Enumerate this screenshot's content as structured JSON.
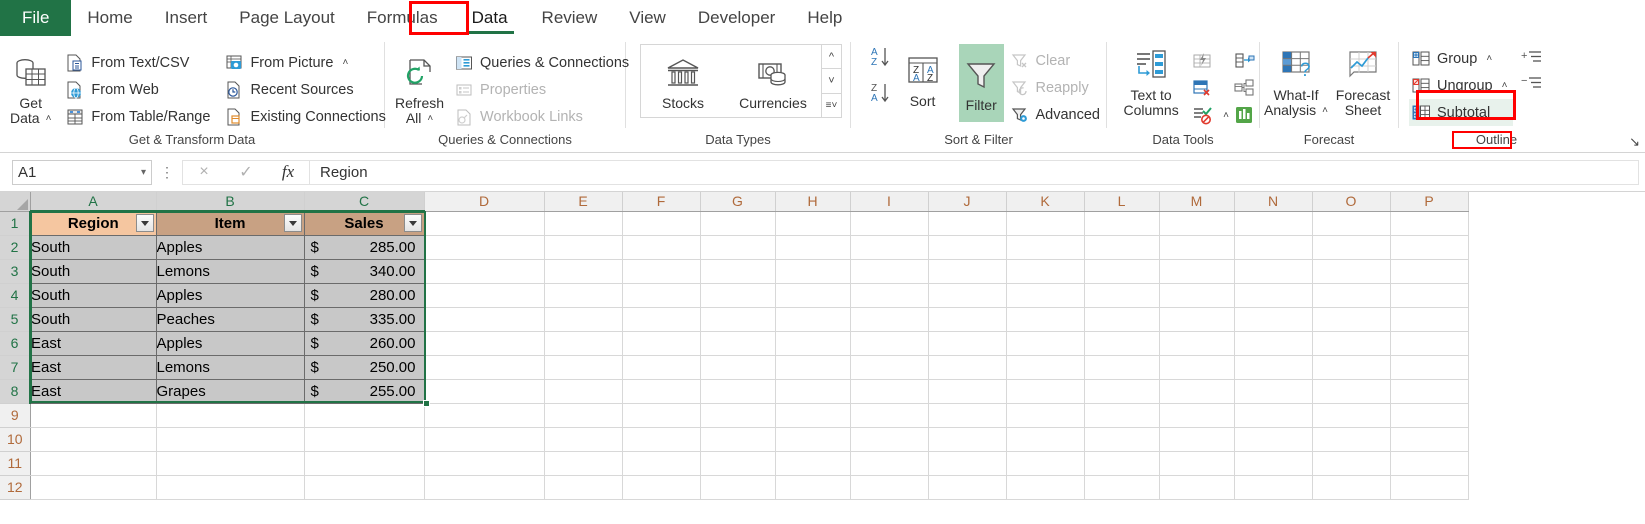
{
  "tabs": [
    {
      "label": "File",
      "type": "file"
    },
    {
      "label": "Home",
      "active": false
    },
    {
      "label": "Insert",
      "active": false
    },
    {
      "label": "Page Layout",
      "active": false
    },
    {
      "label": "Formulas",
      "active": false
    },
    {
      "label": "Data",
      "active": true
    },
    {
      "label": "Review",
      "active": false
    },
    {
      "label": "View",
      "active": false
    },
    {
      "label": "Developer",
      "active": false
    },
    {
      "label": "Help",
      "active": false
    }
  ],
  "ribbon": {
    "get_transform": {
      "group_label": "Get & Transform Data",
      "get_data": {
        "line1": "Get",
        "line2": "Data"
      },
      "items_col1": [
        {
          "label": "From Text/CSV",
          "icon": "text-csv-icon"
        },
        {
          "label": "From Web",
          "icon": "web-icon"
        },
        {
          "label": "From Table/Range",
          "icon": "table-range-icon"
        }
      ],
      "items_col2": [
        {
          "label": "From Picture",
          "icon": "picture-icon",
          "caret": "ˇ"
        },
        {
          "label": "Recent Sources",
          "icon": "recent-icon"
        },
        {
          "label": "Existing Connections",
          "icon": "connections-icon"
        }
      ]
    },
    "queries": {
      "group_label": "Queries & Connections",
      "refresh": {
        "line1": "Refresh",
        "line2": "All",
        "caret": "ˇ"
      },
      "items": [
        {
          "label": "Queries & Connections",
          "icon": "queries-icon",
          "disabled": false
        },
        {
          "label": "Properties",
          "icon": "properties-icon",
          "disabled": true
        },
        {
          "label": "Workbook Links",
          "icon": "workbook-links-icon",
          "disabled": true
        }
      ]
    },
    "data_types": {
      "group_label": "Data Types",
      "items": [
        {
          "label": "Stocks",
          "icon": "stocks-icon"
        },
        {
          "label": "Currencies",
          "icon": "currencies-icon"
        }
      ]
    },
    "sort_filter": {
      "group_label": "Sort & Filter",
      "sort_az": "A↓",
      "sort_za": "Z↓",
      "sort": "Sort",
      "filter": "Filter",
      "filter_active": true,
      "items": [
        {
          "label": "Clear",
          "icon": "clear-filter-icon",
          "disabled": true
        },
        {
          "label": "Reapply",
          "icon": "reapply-icon",
          "disabled": true
        },
        {
          "label": "Advanced",
          "icon": "advanced-filter-icon",
          "disabled": false
        }
      ]
    },
    "data_tools": {
      "group_label": "Data Tools",
      "text_to_columns": {
        "line1": "Text to",
        "line2": "Columns"
      },
      "icons": [
        "flash-fill-icon",
        "remove-duplicates-icon",
        "data-validation-icon",
        "consolidate-icon",
        "relationships-icon",
        "manage-data-model-icon"
      ],
      "validation_caret": "ˇ"
    },
    "forecast": {
      "group_label": "Forecast",
      "what_if": {
        "line1": "What-If",
        "line2": "Analysis",
        "caret": "ˇ"
      },
      "forecast_sheet": {
        "line1": "Forecast",
        "line2": "Sheet"
      }
    },
    "outline": {
      "group_label": "Outline",
      "items": [
        {
          "label": "Group",
          "icon": "group-icon",
          "caret": "ˇ"
        },
        {
          "label": "Ungroup",
          "icon": "ungroup-icon",
          "caret": "ˇ"
        },
        {
          "label": "Subtotal",
          "icon": "subtotal-icon",
          "caret": "",
          "highlighted": true
        }
      ],
      "show_detail": "show-detail-icon",
      "hide_detail": "hide-detail-icon",
      "dialog_launcher": "↘"
    },
    "highlight_color": "#ff0000",
    "active_fill": "#a9d5b9"
  },
  "formula_bar": {
    "name_box_value": "A1",
    "name_box_caret": "▾",
    "cancel_icon": "×",
    "enter_icon": "✓",
    "fx_icon": "fx",
    "formula_value": "Region"
  },
  "grid": {
    "columns": [
      "A",
      "B",
      "C",
      "D",
      "E",
      "F",
      "G",
      "H",
      "I",
      "J",
      "K",
      "L",
      "M",
      "N",
      "O",
      "P"
    ],
    "rows": [
      1,
      2,
      3,
      4,
      5,
      6,
      7,
      8,
      9,
      10,
      11,
      12
    ],
    "selected_range": "A1:C8",
    "header_colors": {
      "Region": "#f5c6a0",
      "Item": "#c8a183",
      "Sales": "#c8a183"
    },
    "headers": [
      {
        "label": "Region",
        "filter": true
      },
      {
        "label": "Item",
        "filter": true
      },
      {
        "label": "Sales",
        "filter": true
      }
    ],
    "data": [
      {
        "row": 2,
        "region": "South",
        "item": "Apples",
        "currency": "$",
        "sales": "285.00"
      },
      {
        "row": 3,
        "region": "South",
        "item": "Lemons",
        "currency": "$",
        "sales": "340.00"
      },
      {
        "row": 4,
        "region": "South",
        "item": "Apples",
        "currency": "$",
        "sales": "280.00"
      },
      {
        "row": 5,
        "region": "South",
        "item": "Peaches",
        "currency": "$",
        "sales": "335.00"
      },
      {
        "row": 6,
        "region": "East",
        "item": "Apples",
        "currency": "$",
        "sales": "260.00"
      },
      {
        "row": 7,
        "region": "East",
        "item": "Lemons",
        "currency": "$",
        "sales": "250.00"
      },
      {
        "row": 8,
        "region": "East",
        "item": "Grapes",
        "currency": "$",
        "sales": "255.00"
      }
    ]
  }
}
